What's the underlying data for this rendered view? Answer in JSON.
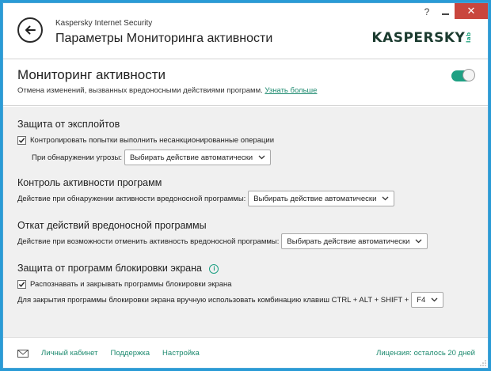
{
  "window": {
    "app_name": "Kaspersky Internet Security",
    "title": "Параметры Мониторинга активности",
    "help": "?",
    "close": "✕"
  },
  "logo": {
    "text": "KASPERSKY",
    "suffix": "lab"
  },
  "header": {
    "title": "Мониторинг активности",
    "description": "Отмена изменений, вызванных вредоносными действиями программ.",
    "link": "Узнать больше",
    "toggle_on": true
  },
  "sections": {
    "exploits": {
      "title": "Защита от эксплойтов",
      "checkbox_label": "Контролировать попытки выполнить несанкционированные операции",
      "checkbox_checked": true,
      "threat_label": "При обнаружении угрозы:",
      "threat_value": "Выбирать действие автоматически"
    },
    "program_control": {
      "title": "Контроль активности программ",
      "action_label": "Действие при обнаружении активности вредоносной программы:",
      "action_value": "Выбирать действие автоматически"
    },
    "rollback": {
      "title": "Откат действий вредоносной программы",
      "action_label": "Действие при возможности отменить активность вредоносной программы:",
      "action_value": "Выбирать действие автоматически"
    },
    "screen_lockers": {
      "title": "Защита от программ блокировки экрана",
      "info": "i",
      "checkbox_label": "Распознавать и закрывать программы блокировки экрана",
      "checkbox_checked": true,
      "shortcut_label": "Для закрытия программы блокировки экрана вручную использовать комбинацию клавиш CTRL + ALT + SHIFT +",
      "shortcut_value": "F4"
    }
  },
  "footer": {
    "links": [
      "Личный кабинет",
      "Поддержка",
      "Настройка"
    ],
    "license": "Лицензия: осталось 20 дней"
  },
  "colors": {
    "accent": "#1ea083",
    "link": "#1d8a6f",
    "close": "#c9463d",
    "desktop": "#2a9bd6"
  }
}
